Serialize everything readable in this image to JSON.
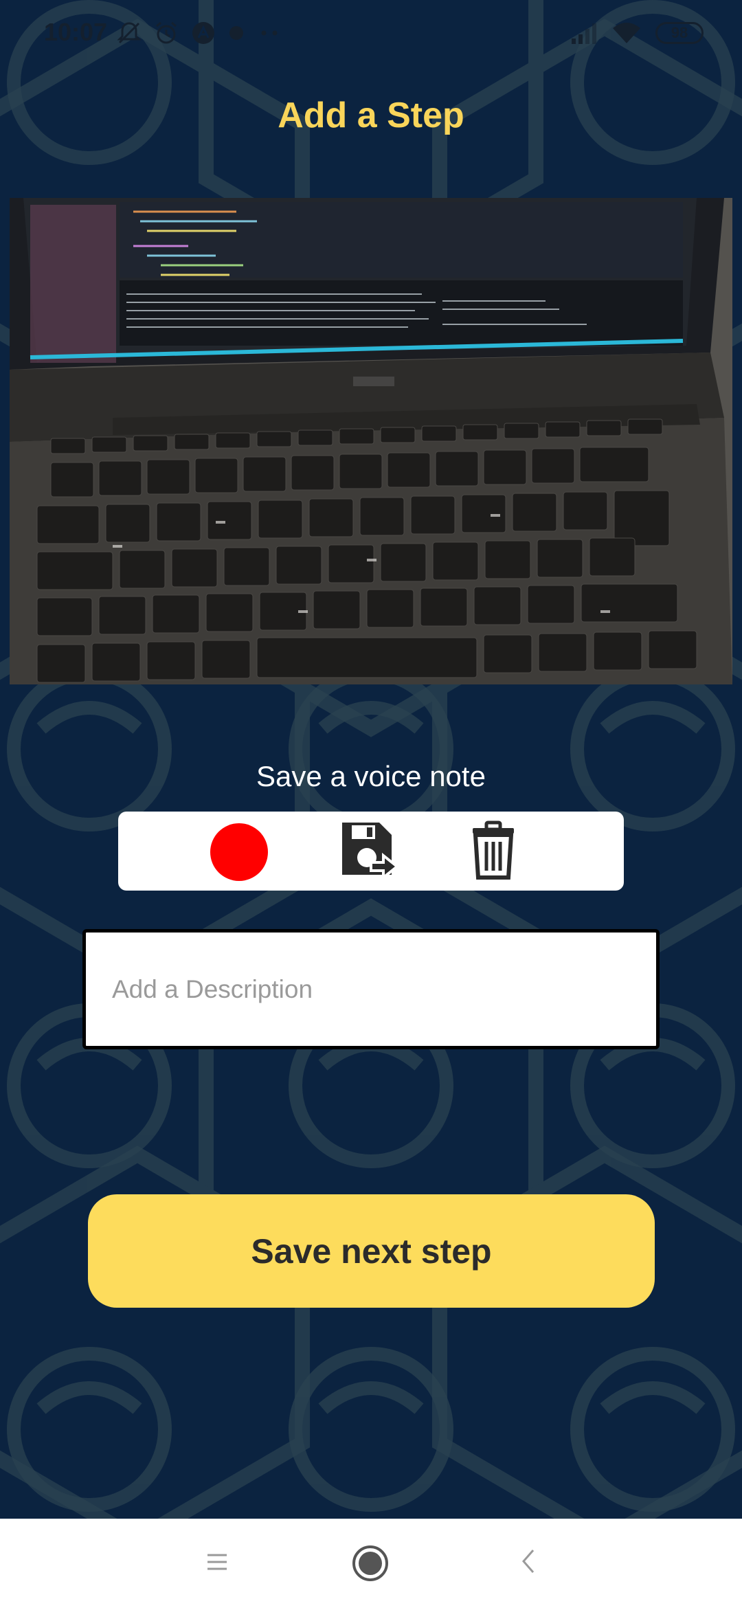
{
  "status_bar": {
    "time": "10:07",
    "battery": "98",
    "icons_left": [
      "mute-icon",
      "alarm-icon",
      "vpn-icon",
      "dot-icon",
      "more-dots-icon"
    ],
    "icons_right": [
      "signal-icon",
      "wifi-icon",
      "battery-icon"
    ]
  },
  "title": "Add a Step",
  "photo": {
    "subject": "laptop-keyboard-photo"
  },
  "voice_note": {
    "label": "Save a voice note",
    "record_color": "#ff0000",
    "buttons": [
      "record-icon",
      "save-audio-icon",
      "trash-icon"
    ]
  },
  "description": {
    "placeholder": "Add a Description",
    "value": ""
  },
  "save_button": {
    "label": "Save next step",
    "color": "#fddc5c"
  },
  "colors": {
    "background": "#0b2340",
    "pattern": "#2a4250",
    "title": "#f9d55a"
  },
  "nav_bar": {
    "icons": [
      "menu-icon",
      "home-icon",
      "back-icon"
    ]
  }
}
